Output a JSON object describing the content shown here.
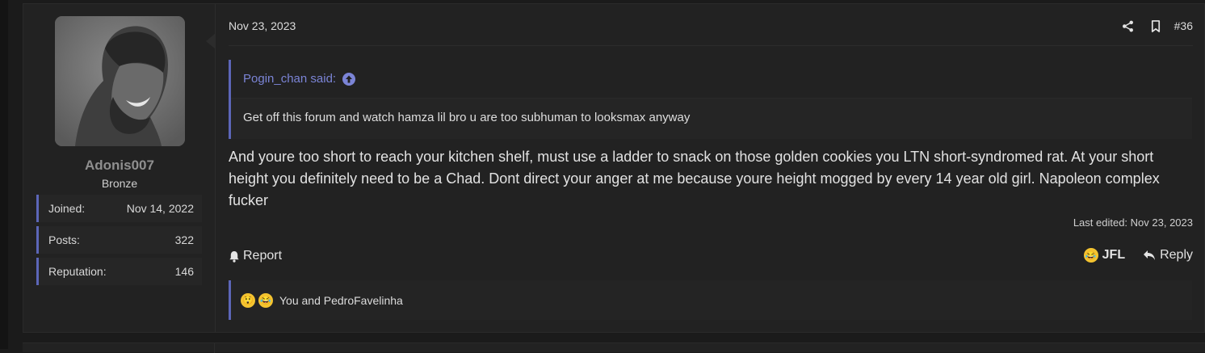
{
  "post": {
    "date": "Nov 23, 2023",
    "post_number": "#36",
    "user": {
      "username": "Adonis007",
      "rank": "Bronze",
      "stats": [
        {
          "label": "Joined:",
          "value": "Nov 14, 2022"
        },
        {
          "label": "Posts:",
          "value": "322"
        },
        {
          "label": "Reputation:",
          "value": "146"
        }
      ]
    },
    "quote": {
      "author": "Pogin_chan said:",
      "text": "Get off this forum and watch hamza lil bro u are too subhuman to looksmax anyway"
    },
    "message": "And youre too short to reach your kitchen shelf, must use a ladder to snack on those golden cookies you LTN short-syndromed rat. At your short height you definitely need to be a Chad. Dont direct your anger at me because youre height mogged by every 14 year old girl. Napoleon complex fucker",
    "last_edited": "Last edited: Nov 23, 2023",
    "actions": {
      "report": "Report",
      "reaction": "JFL",
      "reply": "Reply"
    },
    "reactions_summary": "You and PedroFavelinha",
    "icons": {
      "share": "share-icon",
      "bookmark": "bookmark-icon",
      "quote_arrow": "arrow-up-circle-icon",
      "report": "bell-icon",
      "reply": "reply-arrow-icon",
      "reaction_1": "shocked-emoji-icon",
      "reaction_2": "laughing-crying-emoji-icon"
    },
    "colors": {
      "accent": "#5c66b8",
      "quote_author": "#7b84d6",
      "background": "#222222"
    }
  }
}
